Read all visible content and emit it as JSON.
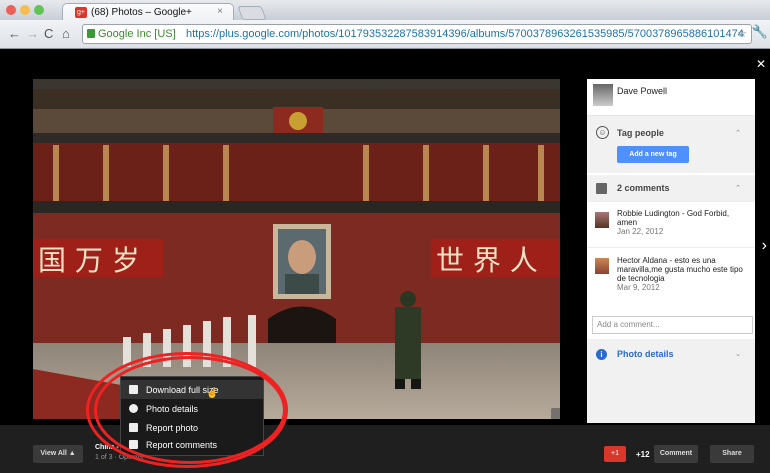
{
  "browser": {
    "tab_count_title": "(68) Photos – Google+",
    "tab_close": "×",
    "identity": "Google Inc [US]",
    "url": "https://plus.google.com/photos/101793532287583914396/albums/5700378963261535985/5700378965886101474"
  },
  "panel": {
    "owner": "Dave Powell",
    "tag_section": "Tag people",
    "add_tag_button": "Add a new tag",
    "comments_section": "2 comments",
    "comments": [
      {
        "author_text": "Robbie Ludington - God Forbid, amen",
        "date": "Jan 22, 2012"
      },
      {
        "author_text": "Hector Aldana - esto es una maravilla,me gusta mucho este tipo de tecnologia",
        "date": "Mar 9, 2012"
      }
    ],
    "add_comment_placeholder": "Add a comment...",
    "details_section": "Photo details"
  },
  "menu": {
    "items": [
      "Download full size",
      "Photo details",
      "Report photo",
      "Report comments"
    ]
  },
  "bottom": {
    "view_all": "View All",
    "album": "China -",
    "position": "1 of 3 · Options",
    "plusone": "+1",
    "plus_count": "+12",
    "comment_button": "Comment",
    "share_button": "Share"
  },
  "photo_text": {
    "banner_left": "国 万 岁",
    "banner_right": "世 界 人"
  },
  "colors": {
    "accent": "#4d90fe",
    "plusone": "#d9372a",
    "annotation": "#e22222"
  }
}
